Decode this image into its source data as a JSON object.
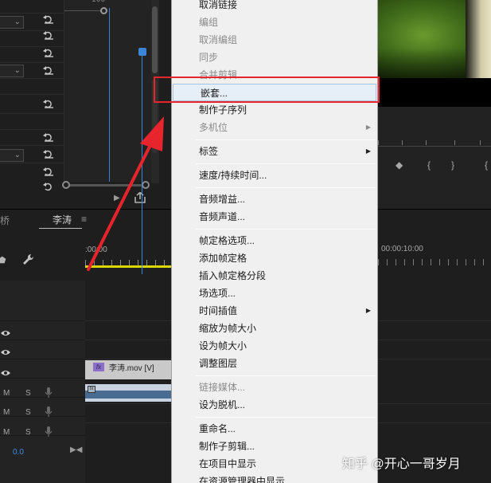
{
  "effect_controls": {
    "ruler_label": "100"
  },
  "timeline": {
    "tab_previous": "桥",
    "tab_active": "李涛",
    "tab_menu_icon": "≡",
    "time_start": ":00:00",
    "time_end": "00:00:10:00",
    "video_clip_name": "李涛.mov [V]",
    "video_clip_fx": "fx",
    "audio_clip_fx": "fx",
    "mute_label": "M",
    "solo_label": "S",
    "master_level": "0.0"
  },
  "context_menu": {
    "items": [
      {
        "label": "取消链接",
        "disabled": false
      },
      {
        "label": "编组",
        "disabled": true
      },
      {
        "label": "取消编组",
        "disabled": true
      },
      {
        "label": "同步",
        "disabled": true
      },
      {
        "label": "合并剪辑...",
        "disabled": true
      },
      {
        "label": "嵌套...",
        "disabled": false,
        "highlighted": true
      },
      {
        "label": "制作子序列",
        "disabled": false
      },
      {
        "label": "多机位",
        "disabled": true,
        "submenu": true
      },
      {
        "label": "标签",
        "disabled": false,
        "submenu": true
      },
      {
        "label": "速度/持续时间...",
        "disabled": false
      },
      {
        "label": "音频增益...",
        "disabled": false
      },
      {
        "label": "音频声道...",
        "disabled": false
      },
      {
        "label": "帧定格选项...",
        "disabled": false
      },
      {
        "label": "添加帧定格",
        "disabled": false
      },
      {
        "label": "插入帧定格分段",
        "disabled": false
      },
      {
        "label": "场选项...",
        "disabled": false
      },
      {
        "label": "时间插值",
        "disabled": false,
        "submenu": true
      },
      {
        "label": "缩放为帧大小",
        "disabled": false
      },
      {
        "label": "设为帧大小",
        "disabled": false
      },
      {
        "label": "调整图层",
        "disabled": false
      },
      {
        "label": "链接媒体...",
        "disabled": true
      },
      {
        "label": "设为脱机...",
        "disabled": false
      },
      {
        "label": "重命名...",
        "disabled": false
      },
      {
        "label": "制作子剪辑...",
        "disabled": false
      },
      {
        "label": "在项目中显示",
        "disabled": false
      },
      {
        "label": "在资源管理器中显示...",
        "disabled": false
      }
    ],
    "submenu_arrow": "▶"
  },
  "program_monitor": {
    "transport": [
      "◆",
      "{",
      "}",
      "{"
    ]
  },
  "colors": {
    "highlight_box": "#e8242c",
    "playhead": "#3d85d8",
    "work_area": "#d9d600"
  },
  "watermark": "知乎 @开心一哥岁月"
}
